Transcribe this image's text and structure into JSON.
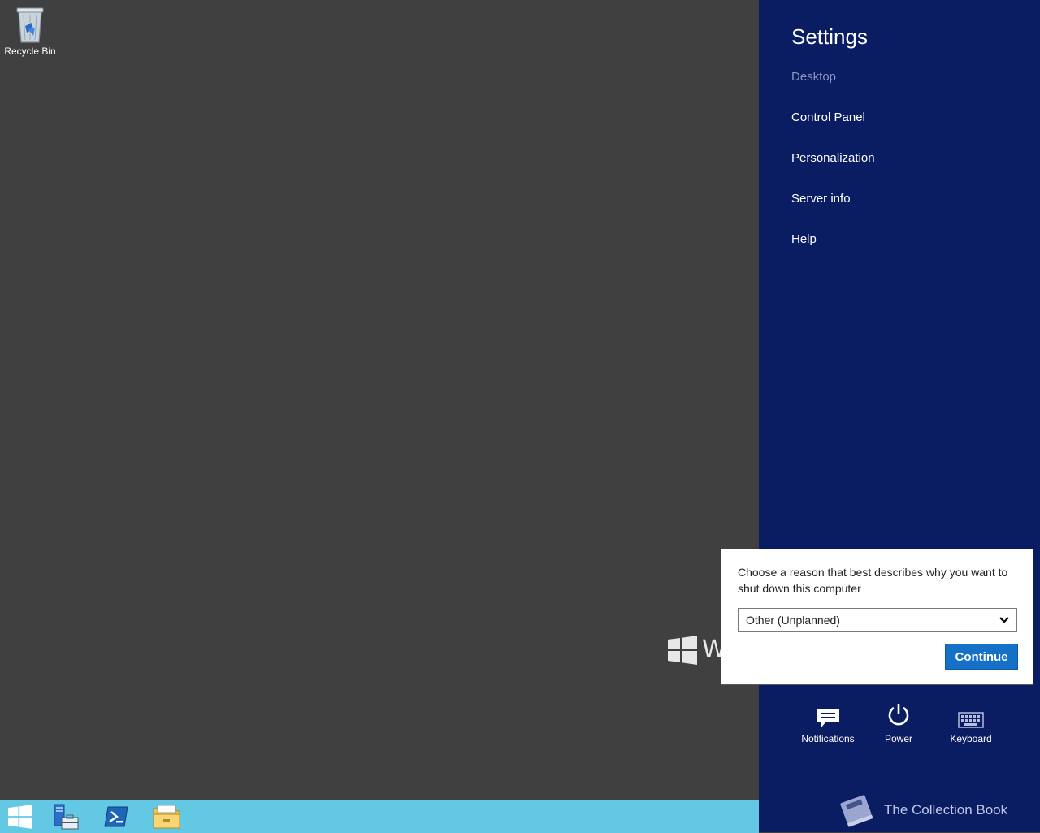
{
  "desktop": {
    "recycle_bin_label": "Recycle Bin",
    "background_color": "#404040"
  },
  "taskbar": {
    "color": "#62c8e4",
    "items": [
      {
        "name": "start-icon"
      },
      {
        "name": "server-manager-icon"
      },
      {
        "name": "powershell-icon"
      },
      {
        "name": "file-explorer-icon"
      }
    ]
  },
  "settings_charm": {
    "title": "Settings",
    "subtitle": "Desktop",
    "links": [
      "Control Panel",
      "Personalization",
      "Server info",
      "Help"
    ],
    "quick_actions": {
      "notifications": "Notifications",
      "power": "Power",
      "keyboard": "Keyboard"
    },
    "background_color": "#0a1d63"
  },
  "shutdown_dialog": {
    "prompt": "Choose a reason that best describes why you want to shut down this computer",
    "selected_reason": "Other (Unplanned)",
    "continue_label": "Continue",
    "accent_color": "#1570c8"
  },
  "watermark": {
    "brand_text": "The Collection Book"
  }
}
